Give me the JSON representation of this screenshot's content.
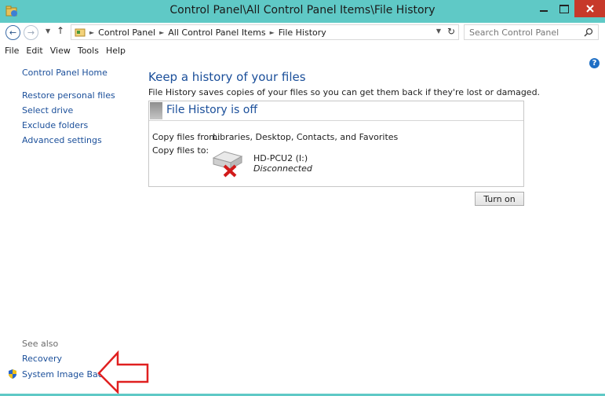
{
  "window": {
    "title": "Control Panel\\All Control Panel Items\\File History"
  },
  "address": {
    "crumbs": [
      "Control Panel",
      "All Control Panel Items",
      "File History"
    ],
    "search_placeholder": "Search Control Panel"
  },
  "menu": [
    "File",
    "Edit",
    "View",
    "Tools",
    "Help"
  ],
  "help_glyph": "?",
  "left_pane": {
    "links": [
      "Control Panel Home",
      "Restore personal files",
      "Select drive",
      "Exclude folders",
      "Advanced settings"
    ],
    "see_also_title": "See also",
    "see_also": [
      "Recovery",
      "System Image Backup"
    ]
  },
  "main": {
    "heading": "Keep a history of your files",
    "description": "File History saves copies of your files so you can get them back if they're lost or damaged.",
    "status_title": "File History is off",
    "copy_from_label": "Copy files from:",
    "copy_from_value": "Libraries, Desktop, Contacts, and Favorites",
    "copy_to_label": "Copy files to:",
    "drive_name": "HD-PCU2 (I:)",
    "drive_status": "Disconnected",
    "turn_on_label": "Turn on"
  },
  "colors": {
    "window_frame": "#5fc9c6",
    "close_button": "#c7392a",
    "link": "#1b4f9a",
    "annotation_arrow": "#e02020"
  }
}
